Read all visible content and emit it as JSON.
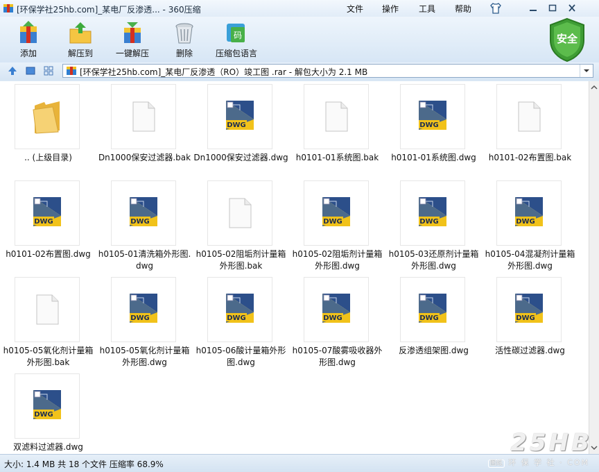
{
  "window": {
    "title": "[环保学社25hb.com]_某电厂反渗透... - 360压缩",
    "menu": [
      "文件",
      "操作",
      "工具",
      "帮助"
    ]
  },
  "toolbar": {
    "add": "添加",
    "extract_to": "解压到",
    "one_click_extract": "一键解压",
    "delete": "删除",
    "compress_language": "压缩包语言"
  },
  "security_badge": "安全",
  "address": {
    "path": "[环保学社25hb.com]_某电厂反渗透（RO）竣工图 .rar - 解包大小为 2.1 MB"
  },
  "files": [
    {
      "name": ".. (上级目录)",
      "type": "folder"
    },
    {
      "name": "Dn1000保安过滤器.bak",
      "type": "bak"
    },
    {
      "name": "Dn1000保安过滤器.dwg",
      "type": "dwg"
    },
    {
      "name": "h0101-01系统图.bak",
      "type": "bak"
    },
    {
      "name": "h0101-01系统图.dwg",
      "type": "dwg"
    },
    {
      "name": "h0101-02布置图.bak",
      "type": "bak"
    },
    {
      "name": "h0101-02布置图.dwg",
      "type": "dwg"
    },
    {
      "name": "h0105-01清洗箱外形图.\ndwg",
      "type": "dwg"
    },
    {
      "name": "h0105-02阻垢剂计量箱\n外形图.bak",
      "type": "bak"
    },
    {
      "name": "h0105-02阻垢剂计量箱\n外形图.dwg",
      "type": "dwg"
    },
    {
      "name": "h0105-03还原剂计量箱\n外形图.dwg",
      "type": "dwg"
    },
    {
      "name": "h0105-04混凝剂计量箱\n外形图.dwg",
      "type": "dwg"
    },
    {
      "name": "h0105-05氧化剂计量箱\n外形图.bak",
      "type": "bak"
    },
    {
      "name": "h0105-05氧化剂计量箱\n外形图.dwg",
      "type": "dwg"
    },
    {
      "name": "h0105-06酸计量箱外形\n图.dwg",
      "type": "dwg"
    },
    {
      "name": "h0105-07酸雾吸收器外\n形图.dwg",
      "type": "dwg"
    },
    {
      "name": "反渗透组架图.dwg",
      "type": "dwg"
    },
    {
      "name": "活性碳过滤器.dwg",
      "type": "dwg"
    },
    {
      "name": "双滤料过滤器.dwg",
      "type": "dwg"
    }
  ],
  "dwg_label": "DWG",
  "status": "大小: 1.4 MB 共 18 个文件 压缩率 68.9%",
  "watermark": {
    "big": "25HB",
    "small": "环 保 学 社 · COM",
    "badge": "图纸"
  }
}
